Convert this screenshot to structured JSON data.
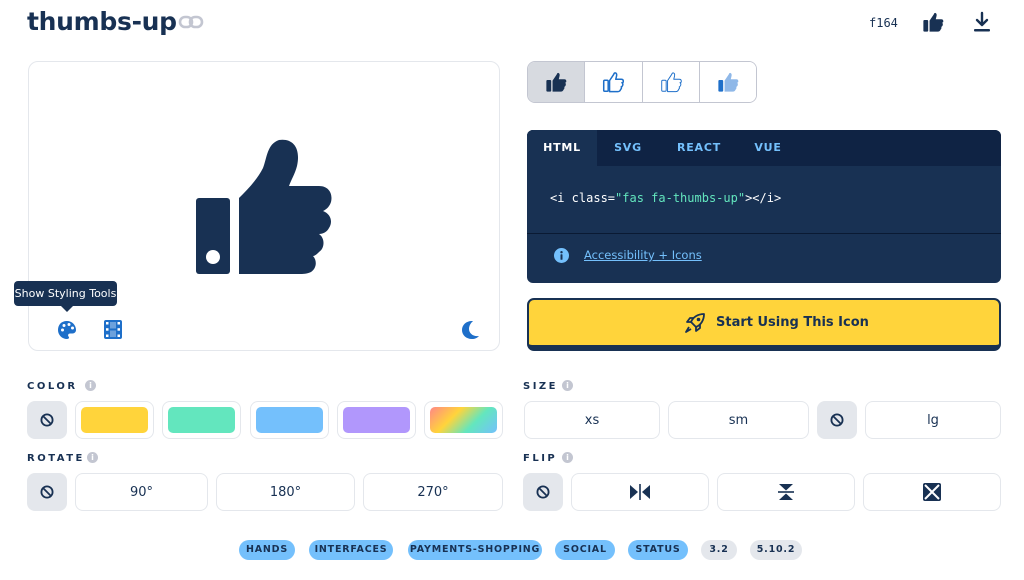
{
  "header": {
    "title": "thumbs-up",
    "unicode": "f164"
  },
  "preview": {
    "tooltip": "Show Styling Tools"
  },
  "code": {
    "tabs": [
      "HTML",
      "SVG",
      "REACT",
      "VUE"
    ],
    "active_tab": "HTML",
    "open": "<i class=",
    "class_value": "\"fas fa-thumbs-up\"",
    "close": "></i>",
    "accessibility_link": "Accessibility + Icons"
  },
  "start_button": "Start Using This Icon",
  "sections": {
    "color": "COLOR",
    "size": "SIZE",
    "rotate": "ROTATE",
    "flip": "FLIP"
  },
  "size_options": [
    "xs",
    "sm",
    "lg"
  ],
  "rotate_options": [
    "90°",
    "180°",
    "270°"
  ],
  "colors": {
    "navy": "#183153",
    "swatches": [
      "#ffd43b",
      "#63e6be",
      "#74c0fc",
      "#b197fc",
      "gradient"
    ]
  },
  "tags": {
    "categories": [
      "HANDS",
      "INTERFACES",
      "PAYMENTS-SHOPPING",
      "SOCIAL",
      "STATUS"
    ],
    "versions": [
      "3.2",
      "5.10.2"
    ]
  }
}
